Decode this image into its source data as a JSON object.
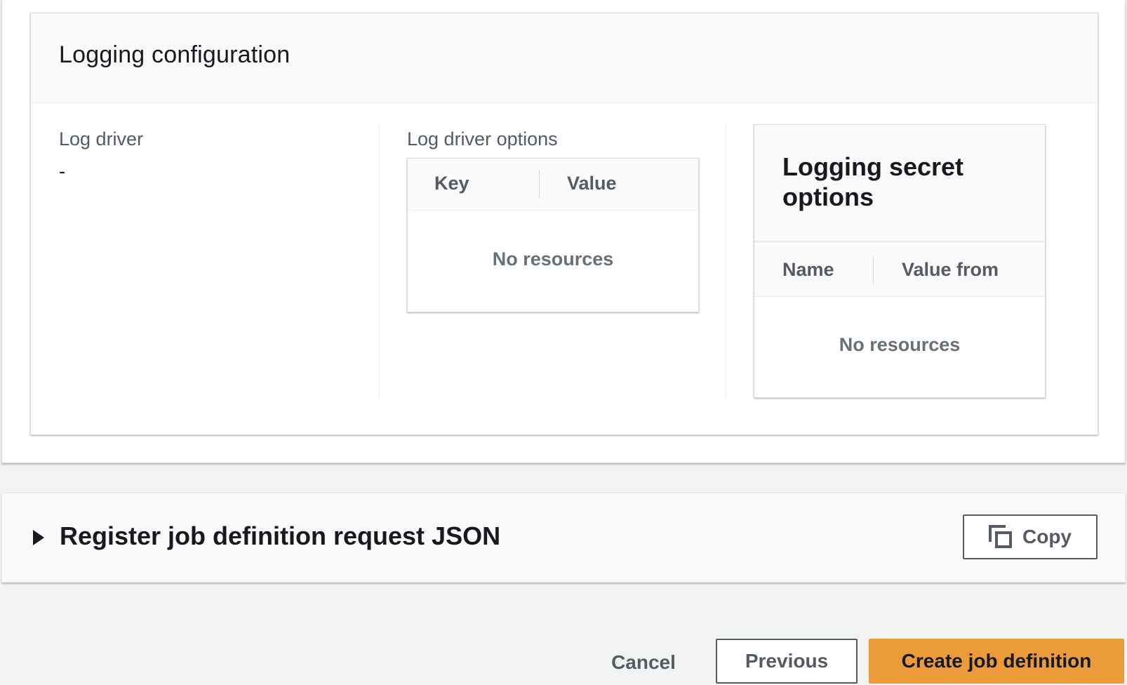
{
  "logging_configuration": {
    "title": "Logging configuration",
    "log_driver": {
      "label": "Log driver",
      "value": "-"
    },
    "log_driver_options": {
      "label": "Log driver options",
      "columns": [
        "Key",
        "Value"
      ],
      "empty_text": "No resources"
    },
    "logging_secret_options": {
      "title_line1": "Logging secret",
      "title_line2": "options",
      "columns": [
        "Name",
        "Value from"
      ],
      "empty_text": "No resources"
    }
  },
  "json_section": {
    "title": "Register job definition request JSON",
    "copy_label": "Copy",
    "expand_icon": "caret-right-icon",
    "copy_icon": "copy-icon"
  },
  "footer": {
    "cancel_label": "Cancel",
    "previous_label": "Previous",
    "create_label": "Create job definition"
  },
  "colors": {
    "primary_button": "#ec9b3a",
    "page_background": "#f2f3f3",
    "secondary_text": "#545b64"
  }
}
